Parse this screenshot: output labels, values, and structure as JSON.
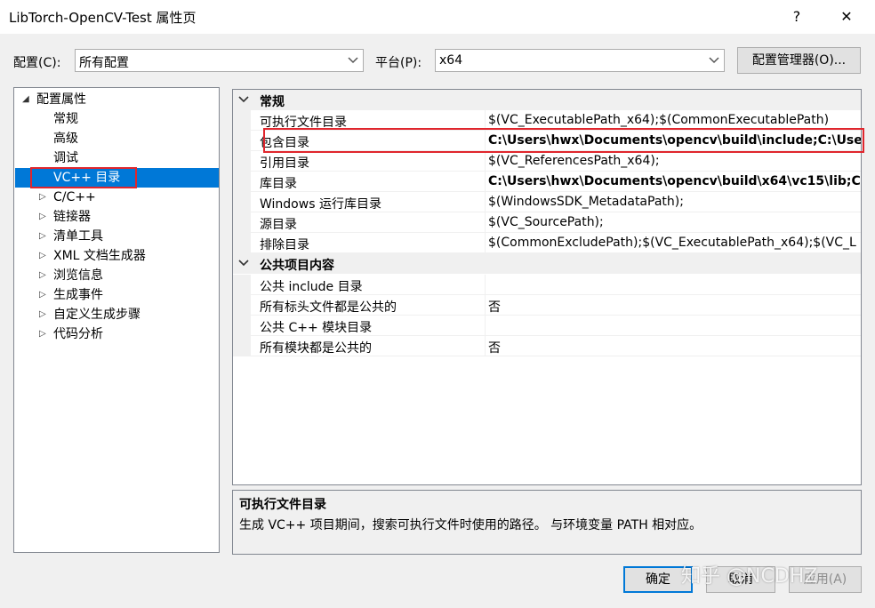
{
  "window": {
    "title": "LibTorch-OpenCV-Test 属性页",
    "help": "?",
    "close": "✕"
  },
  "config": {
    "label": "配置(C):",
    "value": "所有配置"
  },
  "platform": {
    "label": "平台(P):",
    "value": "x64"
  },
  "config_manager": "配置管理器(O)...",
  "tree": {
    "root": "配置属性",
    "items": [
      {
        "label": "常规"
      },
      {
        "label": "高级"
      },
      {
        "label": "调试"
      },
      {
        "label": "VC++ 目录",
        "selected": true
      },
      {
        "label": "C/C++"
      },
      {
        "label": "链接器"
      },
      {
        "label": "清单工具"
      },
      {
        "label": "XML 文档生成器"
      },
      {
        "label": "浏览信息"
      },
      {
        "label": "生成事件"
      },
      {
        "label": "自定义生成步骤"
      },
      {
        "label": "代码分析"
      }
    ]
  },
  "grid": {
    "categories": [
      {
        "label": "常规",
        "rows": [
          {
            "name": "可执行文件目录",
            "value": "$(VC_ExecutablePath_x64);$(CommonExecutablePath)"
          },
          {
            "name": "包含目录",
            "value": "C:\\Users\\hwx\\Documents\\opencv\\build\\include;C:\\Use",
            "bold": true
          },
          {
            "name": "引用目录",
            "value": "$(VC_ReferencesPath_x64);"
          },
          {
            "name": "库目录",
            "value": "C:\\Users\\hwx\\Documents\\opencv\\build\\x64\\vc15\\lib;C",
            "bold": true
          },
          {
            "name": "Windows 运行库目录",
            "value": "$(WindowsSDK_MetadataPath);"
          },
          {
            "name": "源目录",
            "value": "$(VC_SourcePath);"
          },
          {
            "name": "排除目录",
            "value": "$(CommonExcludePath);$(VC_ExecutablePath_x64);$(VC_L"
          }
        ]
      },
      {
        "label": "公共项目内容",
        "rows": [
          {
            "name": "公共 include 目录",
            "value": ""
          },
          {
            "name": "所有标头文件都是公共的",
            "value": "否"
          },
          {
            "name": "公共 C++ 模块目录",
            "value": ""
          },
          {
            "name": "所有模块都是公共的",
            "value": "否"
          }
        ]
      }
    ]
  },
  "description": {
    "title": "可执行文件目录",
    "text": "生成 VC++ 项目期间，搜索可执行文件时使用的路径。 与环境变量 PATH 相对应。"
  },
  "buttons": {
    "ok": "确定",
    "cancel": "取消",
    "apply": "应用(A)"
  },
  "watermark": "知乎 @NCDHZ",
  "highlight_color": "#e0262d",
  "selection_color": "#0078d7"
}
